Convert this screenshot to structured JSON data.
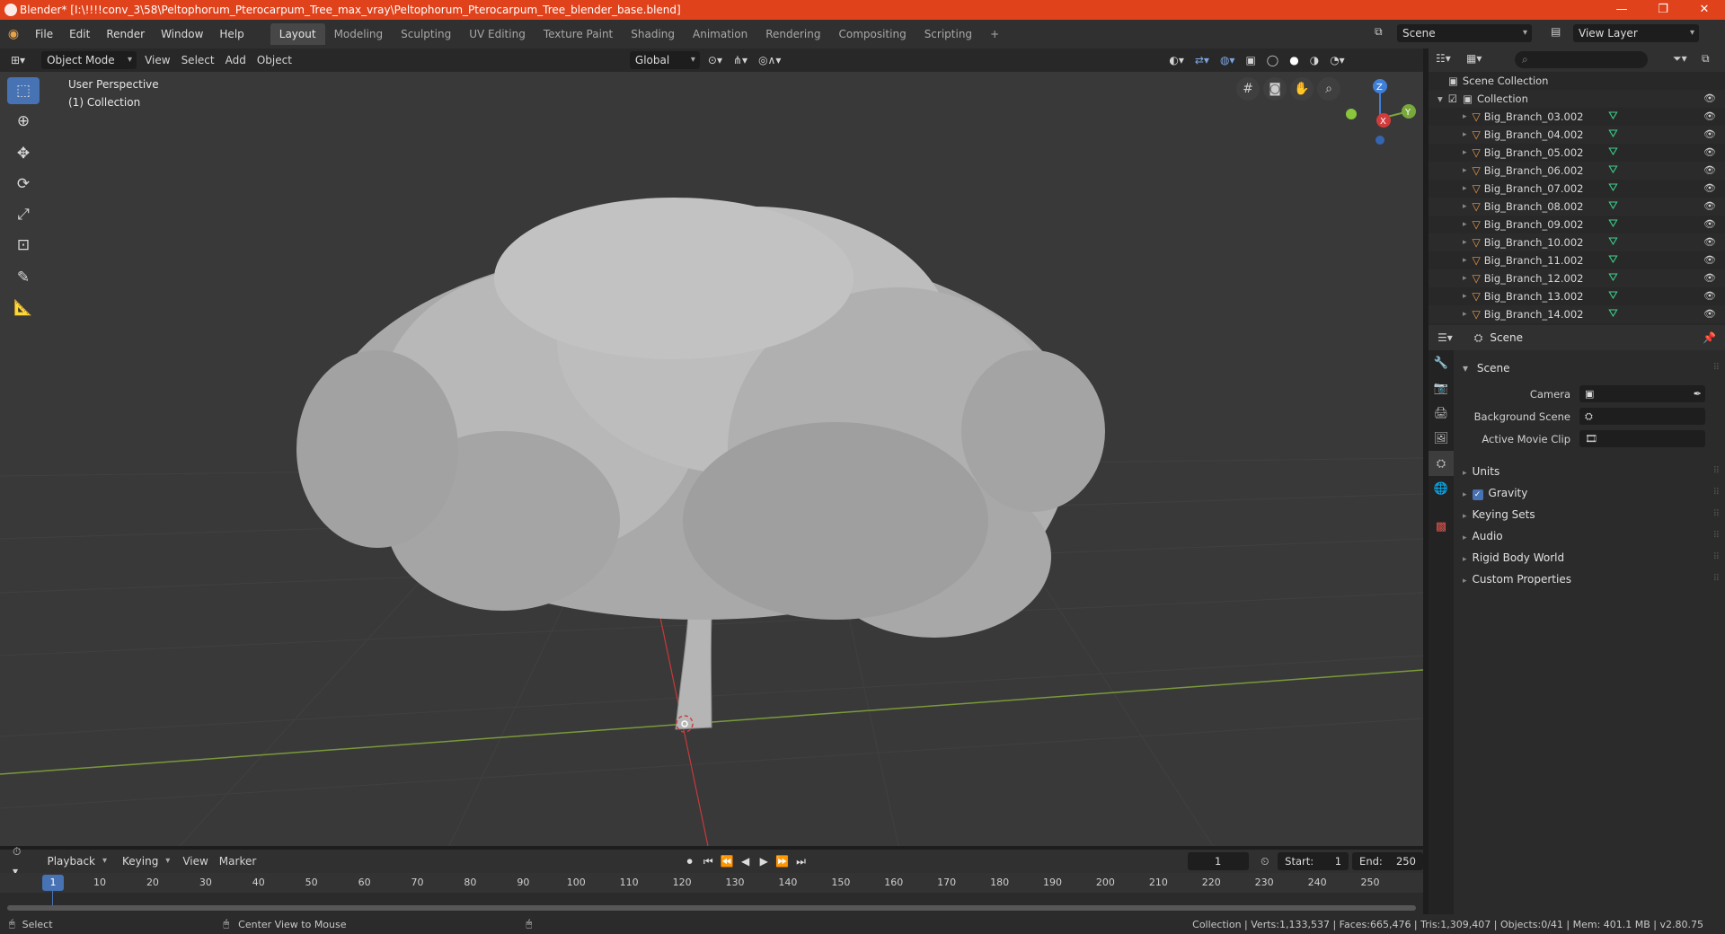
{
  "title": "Blender* [I:\\!!!!conv_3\\58\\Peltophorum_Pterocarpum_Tree_max_vray\\Peltophorum_Pterocarpum_Tree_blender_base.blend]",
  "window_controls": {
    "minimize": "—",
    "maximize": "❐",
    "close": "✕"
  },
  "menus": [
    "File",
    "Edit",
    "Render",
    "Window",
    "Help"
  ],
  "workspaces": [
    "Layout",
    "Modeling",
    "Sculpting",
    "UV Editing",
    "Texture Paint",
    "Shading",
    "Animation",
    "Rendering",
    "Compositing",
    "Scripting",
    "+"
  ],
  "scene_name": "Scene",
  "view_layer": "View Layer",
  "viewport_header": {
    "mode": "Object Mode",
    "menus": [
      "View",
      "Select",
      "Add",
      "Object"
    ],
    "transform": "Global"
  },
  "viewport": {
    "perspective": "User Perspective",
    "collection": "(1) Collection",
    "axis": {
      "x": "X",
      "y": "Y",
      "z": "Z"
    }
  },
  "outliner": {
    "root": "Scene Collection",
    "collection": "Collection",
    "items": [
      "Big_Branch_03.002",
      "Big_Branch_04.002",
      "Big_Branch_05.002",
      "Big_Branch_06.002",
      "Big_Branch_07.002",
      "Big_Branch_08.002",
      "Big_Branch_09.002",
      "Big_Branch_10.002",
      "Big_Branch_11.002",
      "Big_Branch_12.002",
      "Big_Branch_13.002",
      "Big_Branch_14.002"
    ]
  },
  "properties": {
    "context": "Scene",
    "section": "Scene",
    "fields": [
      {
        "label": "Camera",
        "value": ""
      },
      {
        "label": "Background Scene",
        "value": ""
      },
      {
        "label": "Active Movie Clip",
        "value": ""
      }
    ],
    "subsections": [
      "Units",
      "Gravity",
      "Keying Sets",
      "Audio",
      "Rigid Body World",
      "Custom Properties"
    ]
  },
  "timeline": {
    "menus": [
      "Playback",
      "Keying",
      "View",
      "Marker"
    ],
    "current_frame": "1",
    "start_label": "Start:",
    "start": "1",
    "end_label": "End:",
    "end": "250",
    "ticks": [
      "1",
      "10",
      "20",
      "30",
      "40",
      "50",
      "60",
      "70",
      "80",
      "90",
      "100",
      "110",
      "120",
      "130",
      "140",
      "150",
      "160",
      "170",
      "180",
      "190",
      "200",
      "210",
      "220",
      "230",
      "240",
      "250"
    ]
  },
  "status": {
    "left": "Select",
    "middle": "Center View to Mouse",
    "right": "Collection | Verts:1,133,537 | Faces:665,476 | Tris:1,309,407 | Objects:0/41 | Mem: 401.1 MB | v2.80.75"
  }
}
